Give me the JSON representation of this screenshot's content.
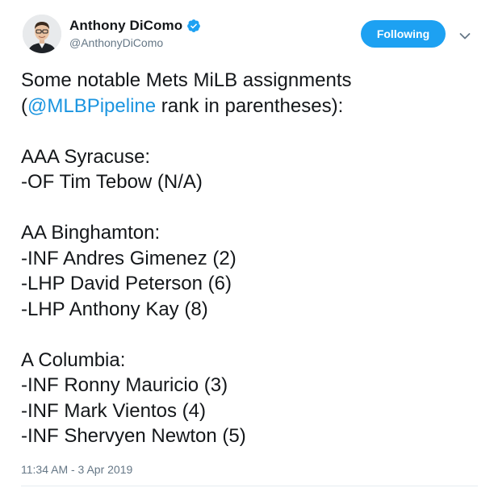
{
  "author": {
    "display_name": "Anthony DiComo",
    "handle": "@AnthonyDiComo",
    "verified_icon": "verified-badge-icon"
  },
  "actions": {
    "follow_label": "Following",
    "more_icon": "chevron-down-icon"
  },
  "colors": {
    "accent": "#1da1f2",
    "link": "#1b95e0",
    "muted": "#657786",
    "text": "#14171a"
  },
  "tweet": {
    "line1": "Some notable Mets MiLB assignments",
    "line2_open": "(",
    "line2_mention": "@MLBPipeline",
    "line2_rest": " rank in parentheses):",
    "aaa_header": "AAA Syracuse:",
    "aaa_players": [
      "-OF Tim Tebow (N/A)"
    ],
    "aa_header": "AA Binghamton:",
    "aa_players": [
      "-INF Andres Gimenez (2)",
      "-LHP David Peterson (6)",
      "-LHP Anthony Kay (8)"
    ],
    "a_header": "A Columbia:",
    "a_players": [
      "-INF Ronny Mauricio (3)",
      "-INF Mark Vientos (4)",
      "-INF Shervyen Newton (5)"
    ]
  },
  "timestamp": "11:34 AM - 3 Apr 2019"
}
